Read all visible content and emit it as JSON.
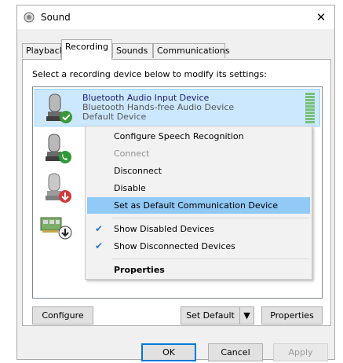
{
  "window": {
    "title": "Sound",
    "close_glyph": "✕"
  },
  "tabs": [
    {
      "label": "Playback",
      "active": false
    },
    {
      "label": "Recording",
      "active": true
    },
    {
      "label": "Sounds",
      "active": false
    },
    {
      "label": "Communications",
      "active": false
    }
  ],
  "panel": {
    "instruction": "Select a recording device below to modify its settings:"
  },
  "devices": [
    {
      "name": "Bluetooth Audio Input Device",
      "sub": "Bluetooth Hands-free Audio Device",
      "status": "Default Device",
      "selected": true,
      "badge": "green-check-badge"
    },
    {
      "badge": "green-phone-badge"
    },
    {
      "badge": "red-down-arrow-badge"
    },
    {
      "badge": "black-down-arrow-badge"
    }
  ],
  "context_menu": {
    "items": [
      {
        "label": "Configure Speech Recognition",
        "state": "normal"
      },
      {
        "label": "Connect",
        "state": "disabled"
      },
      {
        "label": "Disconnect",
        "state": "normal"
      },
      {
        "label": "Disable",
        "state": "normal"
      },
      {
        "label": "Set as Default Communication Device",
        "state": "hover"
      },
      {
        "label": "Show Disabled Devices",
        "state": "checked"
      },
      {
        "label": "Show Disconnected Devices",
        "state": "checked"
      },
      {
        "label": "Properties",
        "state": "bold"
      }
    ],
    "check_glyph": "✔"
  },
  "panel_buttons": {
    "configure": "Configure",
    "set_default": "Set Default",
    "set_default_arrow": "▼",
    "properties": "Properties"
  },
  "dialog_buttons": {
    "ok": "OK",
    "cancel": "Cancel",
    "apply": "Apply"
  },
  "colors": {
    "selection": "#cce8ff",
    "menu_hover": "#91c9f7",
    "level_meter": "#79c07a",
    "accent": "#0078d7"
  }
}
